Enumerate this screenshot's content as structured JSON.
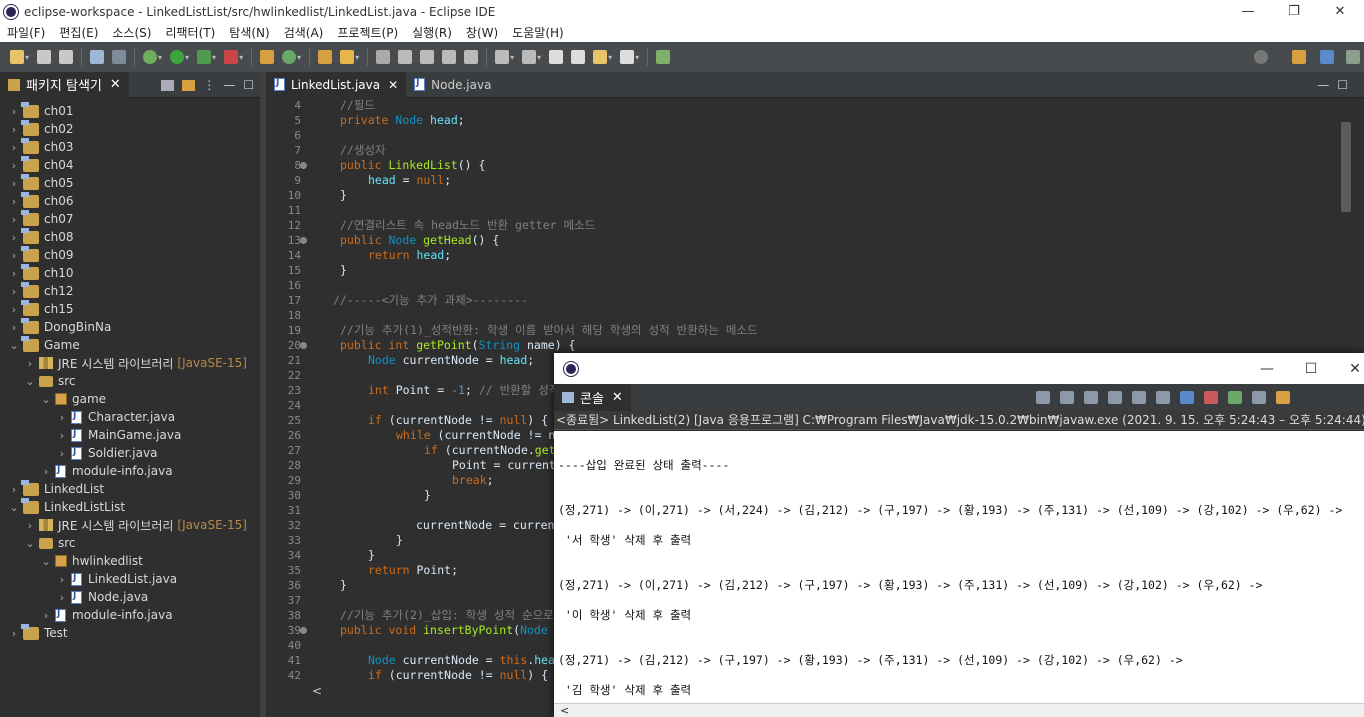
{
  "window": {
    "title": "eclipse-workspace - LinkedListList/src/hwlinkedlist/LinkedList.java - Eclipse IDE",
    "minimize": "—",
    "restore": "❐",
    "close": "✕"
  },
  "menu": [
    "파일(F)",
    "편집(E)",
    "소스(S)",
    "리팩터(T)",
    "탐색(N)",
    "검색(A)",
    "프로젝트(P)",
    "실행(R)",
    "창(W)",
    "도움말(H)"
  ],
  "explorer": {
    "tab_label": "패키지 탐색기",
    "close": "✕",
    "items": [
      {
        "label": "ch01",
        "chev": "›"
      },
      {
        "label": "ch02",
        "chev": "›"
      },
      {
        "label": "ch03",
        "chev": "›"
      },
      {
        "label": "ch04",
        "chev": "›"
      },
      {
        "label": "ch05",
        "chev": "›"
      },
      {
        "label": "ch06",
        "chev": "›"
      },
      {
        "label": "ch07",
        "chev": "›"
      },
      {
        "label": "ch08",
        "chev": "›"
      },
      {
        "label": "ch09",
        "chev": "›"
      },
      {
        "label": "ch10",
        "chev": "›"
      },
      {
        "label": "ch12",
        "chev": "›"
      },
      {
        "label": "ch15",
        "chev": "›"
      },
      {
        "label": "DongBinNa",
        "chev": "›"
      },
      {
        "label": "Game",
        "chev": "⌄"
      },
      {
        "label": "JRE 시스템 라이브러리",
        "extra": "[JavaSE-15]",
        "chev": "›"
      },
      {
        "label": "src",
        "chev": "⌄"
      },
      {
        "label": "game",
        "chev": "⌄"
      },
      {
        "label": "Character.java",
        "chev": "›"
      },
      {
        "label": "MainGame.java",
        "chev": "›"
      },
      {
        "label": "Soldier.java",
        "chev": "›"
      },
      {
        "label": "module-info.java",
        "chev": "›"
      },
      {
        "label": "LinkedList",
        "chev": "›"
      },
      {
        "label": "LinkedListList",
        "chev": "⌄"
      },
      {
        "label": "JRE 시스템 라이브러리",
        "extra": "[JavaSE-15]",
        "chev": "›"
      },
      {
        "label": "src",
        "chev": "⌄"
      },
      {
        "label": "hwlinkedlist",
        "chev": "⌄"
      },
      {
        "label": "LinkedList.java",
        "chev": "›"
      },
      {
        "label": "Node.java",
        "chev": "›"
      },
      {
        "label": "module-info.java",
        "chev": "›"
      },
      {
        "label": "Test",
        "chev": "›"
      }
    ]
  },
  "editor": {
    "tabs": [
      {
        "label": "LinkedList.java",
        "close": "✕"
      },
      {
        "label": "Node.java"
      }
    ],
    "line_numbers": [
      "4",
      "5",
      "6",
      "7",
      "8",
      "9",
      "10",
      "11",
      "12",
      "13",
      "14",
      "15",
      "16",
      "17",
      "18",
      "19",
      "20",
      "21",
      "22",
      "23",
      "24",
      "25",
      "26",
      "27",
      "28",
      "29",
      "30",
      "31",
      "32",
      "33",
      "34",
      "35",
      "36",
      "37",
      "38",
      "39",
      "40",
      "41",
      "42"
    ],
    "hscroll_left": "<"
  },
  "console": {
    "tab_label": "콘솔",
    "close": "✕",
    "status": "<종료됨> LinkedList(2) [Java 응용프로그램] C:₩Program Files₩Java₩jdk-15.0.2₩bin₩javaw.exe (2021. 9. 15. 오후 5:24:43 – 오후 5:24:44)",
    "output": [
      "----삽입 완료된 상태 출력----",
      "(정,271) -> (이,271) -> (서,224) -> (김,212) -> (구,197) -> (황,193) -> (주,131) -> (선,109) -> (강,102) -> (우,62) ->",
      " '서 학생' 삭제 후 출력",
      "(정,271) -> (이,271) -> (김,212) -> (구,197) -> (황,193) -> (주,131) -> (선,109) -> (강,102) -> (우,62) ->",
      " '이 학생' 삭제 후 출력",
      "(정,271) -> (김,212) -> (구,197) -> (황,193) -> (주,131) -> (선,109) -> (강,102) -> (우,62) ->",
      " '김 학생' 삭제 후 출력"
    ],
    "minimize": "—",
    "maximize": "☐",
    "close_window": "✕",
    "hscroll_left": "<"
  }
}
